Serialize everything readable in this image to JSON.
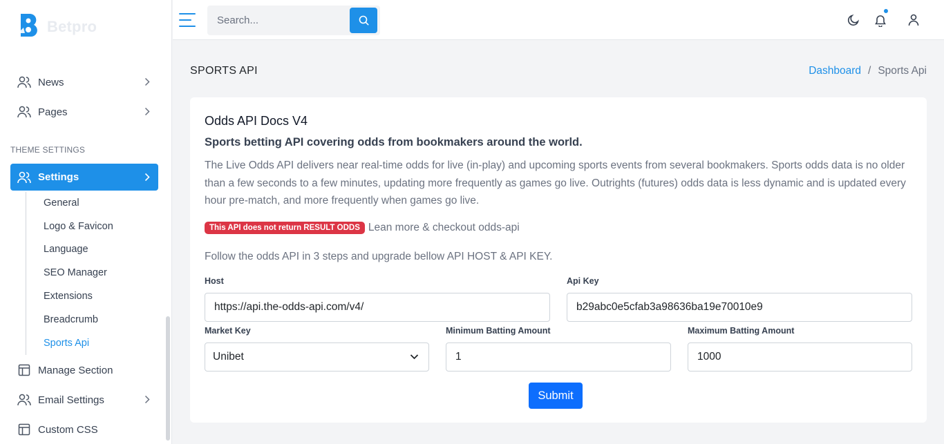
{
  "brand": {
    "name": "Betpro"
  },
  "sidebar": {
    "section_title": "THEME SETTINGS",
    "items": [
      {
        "label": "News"
      },
      {
        "label": "Pages"
      },
      {
        "label": "Settings"
      },
      {
        "label": "Manage Section"
      },
      {
        "label": "Email Settings"
      },
      {
        "label": "Custom CSS"
      }
    ],
    "submenu": [
      {
        "label": "General"
      },
      {
        "label": "Logo & Favicon"
      },
      {
        "label": "Language"
      },
      {
        "label": "SEO Manager"
      },
      {
        "label": "Extensions"
      },
      {
        "label": "Breadcrumb"
      },
      {
        "label": "Sports Api"
      }
    ],
    "active_submenu": "Sports Api"
  },
  "topbar": {
    "search_placeholder": "Search..."
  },
  "page": {
    "title": "SPORTS API",
    "breadcrumb": {
      "parent": "Dashboard",
      "separator": "/",
      "current": "Sports Api"
    }
  },
  "card": {
    "title": "Odds API Docs V4",
    "subtitle": "Sports betting API covering odds from bookmakers around the world.",
    "description": "The Live Odds API delivers near real-time odds for live (in-play) and upcoming sports events from several bookmakers. Sports odds data is no older than a few seconds to a few minutes, updating more frequently as games go live. Outrights (futures) odds data is less dynamic and is updated every hour pre-match, and more frequently when games go live.",
    "badge": "This API does not return RESULT ODDS",
    "badge_link": "Lean more & checkout odds-api",
    "steps_text": "Follow the odds API in 3 steps and upgrade bellow API HOST & API KEY.",
    "form": {
      "host_label": "Host",
      "host_value": "https://api.the-odds-api.com/v4/",
      "api_key_label": "Api Key",
      "api_key_value": "b29abc0e5cfab3a98636ba19e70010e9",
      "market_key_label": "Market Key",
      "market_key_value": "Unibet",
      "min_label": "Minimum Batting Amount",
      "min_value": "1",
      "max_label": "Maximum Batting Amount",
      "max_value": "1000",
      "submit_label": "Submit"
    }
  },
  "colors": {
    "accent": "#1e90e8",
    "submit": "#0d6efd",
    "badge": "#dc3545"
  }
}
